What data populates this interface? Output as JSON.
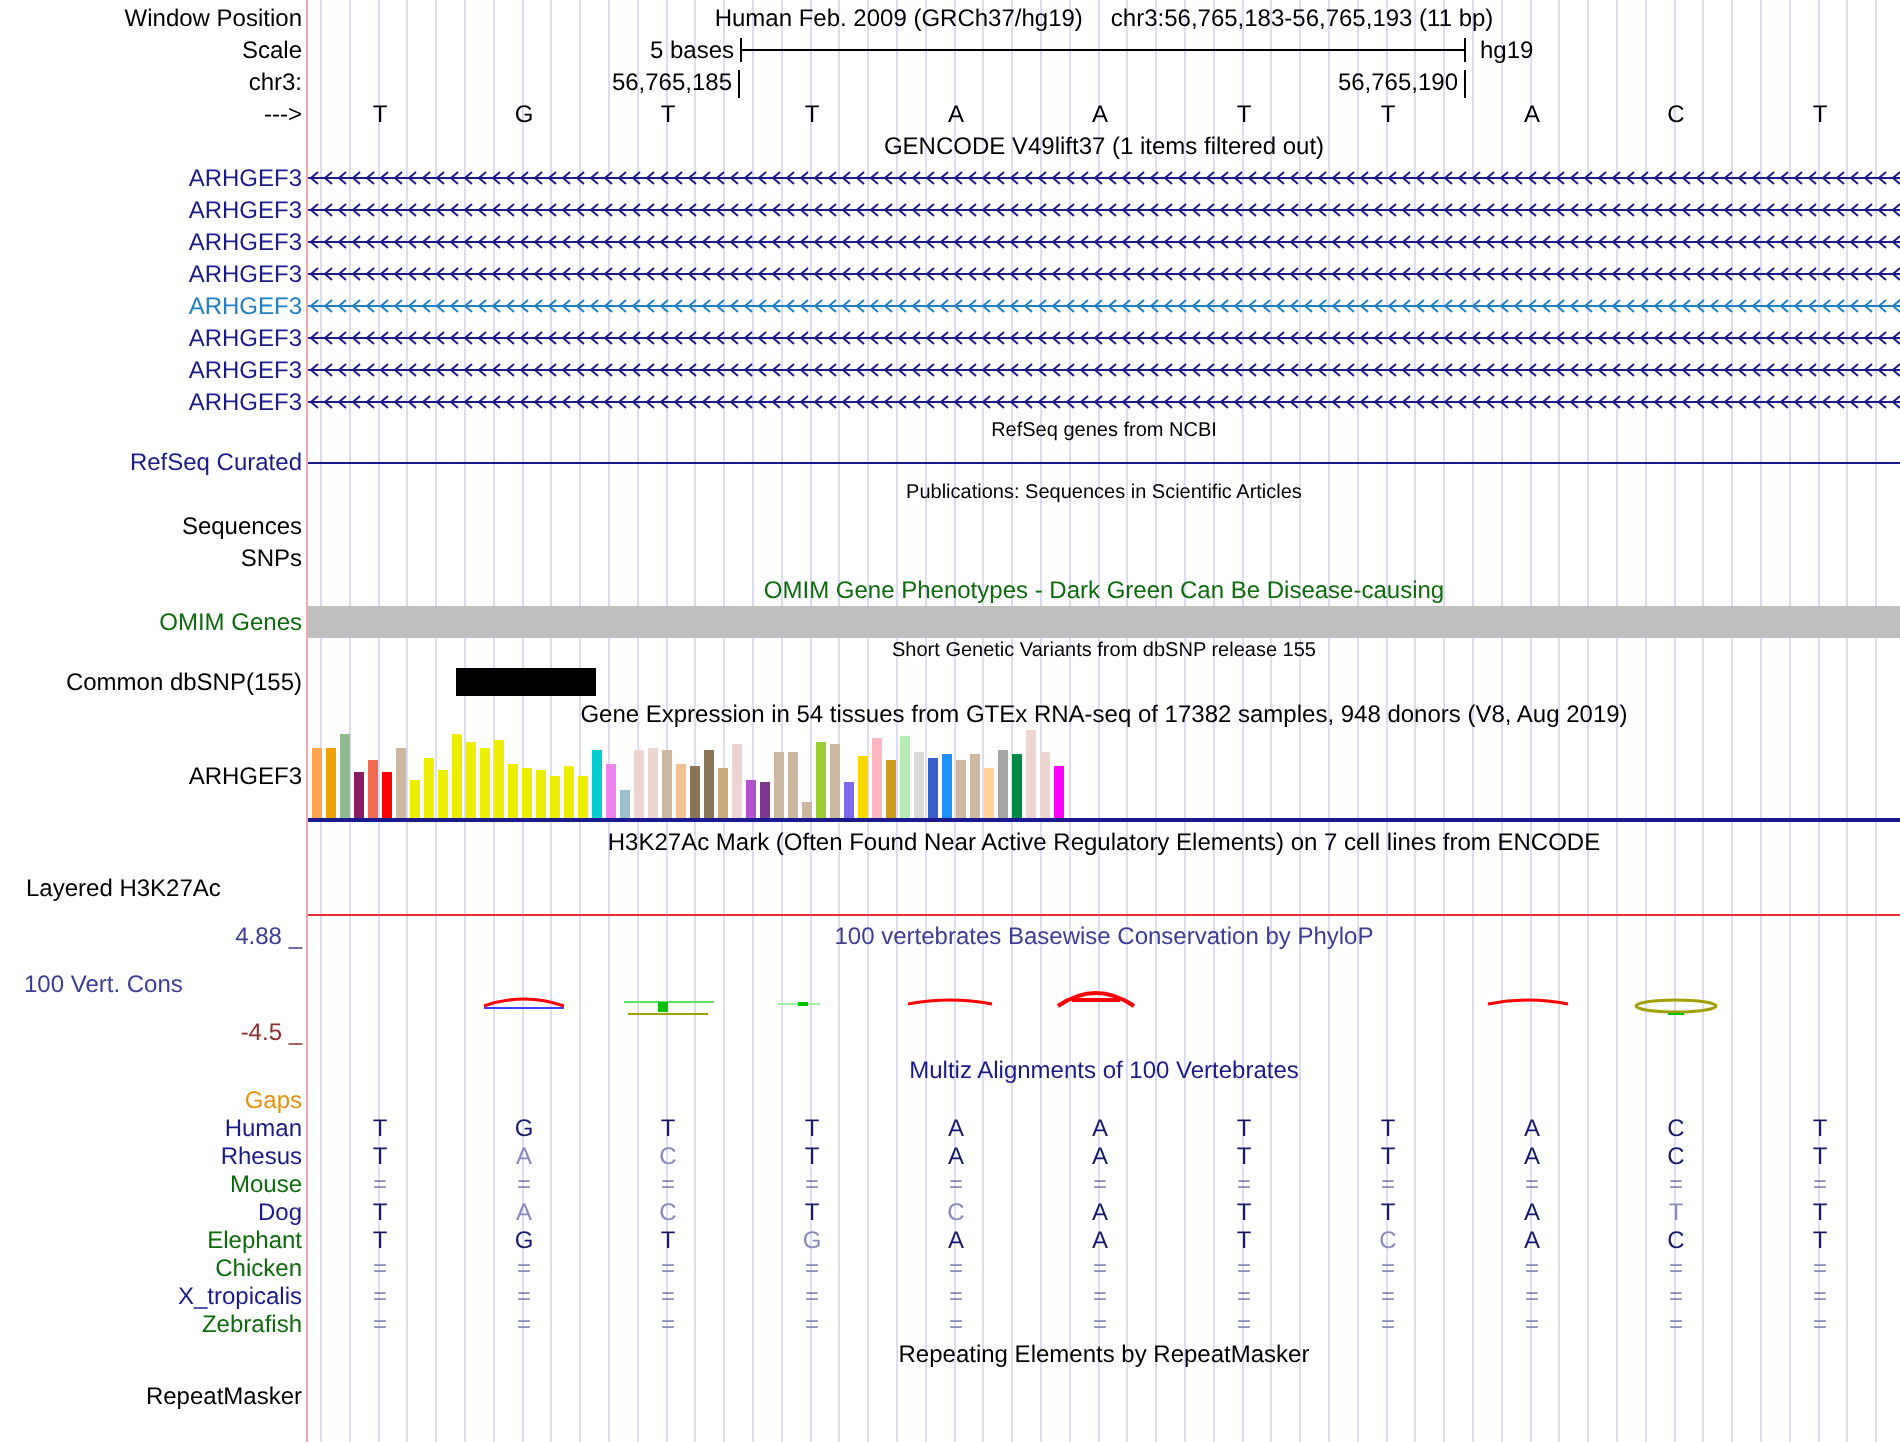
{
  "position": {
    "label": "Window Position",
    "assembly": "Human Feb. 2009 (GRCh37/hg19)",
    "range": "chr3:56,765,183-56,765,193 (11 bp)"
  },
  "scale": {
    "label": "Scale",
    "span": "5 bases",
    "assembly": "hg19"
  },
  "coordinates": {
    "label": "chr3:",
    "start": "56,765,185",
    "end": "56,765,190"
  },
  "sequence": {
    "label": "--->",
    "bases": [
      "T",
      "G",
      "T",
      "T",
      "A",
      "A",
      "T",
      "T",
      "A",
      "C",
      "T"
    ]
  },
  "gencode": {
    "title": "GENCODE V49lift37 (1 items filtered out)",
    "transcripts": [
      {
        "name": "ARHGEF3",
        "color": "#1a1a8c"
      },
      {
        "name": "ARHGEF3",
        "color": "#1a1a8c"
      },
      {
        "name": "ARHGEF3",
        "color": "#1a1a8c"
      },
      {
        "name": "ARHGEF3",
        "color": "#1a1a8c"
      },
      {
        "name": "ARHGEF3",
        "color": "#1f7fc4"
      },
      {
        "name": "ARHGEF3",
        "color": "#1a1a8c"
      },
      {
        "name": "ARHGEF3",
        "color": "#1a1a8c"
      },
      {
        "name": "ARHGEF3",
        "color": "#1a1a8c"
      }
    ]
  },
  "refseq": {
    "title": "RefSeq genes from NCBI",
    "label": "RefSeq Curated"
  },
  "publications": {
    "title": "Publications: Sequences in Scientific Articles",
    "labels": [
      "Sequences",
      "SNPs"
    ]
  },
  "omim": {
    "title": "OMIM Gene Phenotypes - Dark Green Can Be Disease-causing",
    "label": "OMIM Genes"
  },
  "dbsnp": {
    "title": "Short Genetic Variants from dbSNP release 155",
    "label": "Common dbSNP(155)"
  },
  "gtex": {
    "title": "Gene Expression in 54 tissues from GTEx RNA-seq of 17382 samples, 948 donors (V8, Aug 2019)",
    "label": "ARHGEF3"
  },
  "h3k27ac": {
    "title": "H3K27Ac Mark (Often Found Near Active Regulatory Elements) on 7 cell lines from ENCODE",
    "label": "Layered H3K27Ac"
  },
  "conservation": {
    "title": "100 vertebrates Basewise Conservation by PhyloP",
    "label": "100 Vert. Cons",
    "max": "4.88 _",
    "min": "-4.5 _"
  },
  "multiz": {
    "title": "Multiz Alignments of 100 Vertebrates",
    "gaps_label": "Gaps",
    "species": [
      {
        "name": "Human",
        "color": "#1a1a8c",
        "bases": [
          {
            "text": "T",
            "faint": false
          },
          {
            "text": "G",
            "faint": false
          },
          {
            "text": "T",
            "faint": false
          },
          {
            "text": "T",
            "faint": false
          },
          {
            "text": "A",
            "faint": false
          },
          {
            "text": "A",
            "faint": false
          },
          {
            "text": "T",
            "faint": false
          },
          {
            "text": "T",
            "faint": false
          },
          {
            "text": "A",
            "faint": false
          },
          {
            "text": "C",
            "faint": false
          },
          {
            "text": "T",
            "faint": false
          }
        ]
      },
      {
        "name": "Rhesus",
        "color": "#1a1a8c",
        "bases": [
          {
            "text": "T",
            "faint": false
          },
          {
            "text": "A",
            "faint": true
          },
          {
            "text": "C",
            "faint": true
          },
          {
            "text": "T",
            "faint": false
          },
          {
            "text": "A",
            "faint": false
          },
          {
            "text": "A",
            "faint": false
          },
          {
            "text": "T",
            "faint": false
          },
          {
            "text": "T",
            "faint": false
          },
          {
            "text": "A",
            "faint": false
          },
          {
            "text": "C",
            "faint": false
          },
          {
            "text": "T",
            "faint": false
          }
        ]
      },
      {
        "name": "Mouse",
        "color": "#0b6b0b",
        "bases": [
          {
            "text": "=",
            "faint": true
          },
          {
            "text": "=",
            "faint": true
          },
          {
            "text": "=",
            "faint": true
          },
          {
            "text": "=",
            "faint": true
          },
          {
            "text": "=",
            "faint": true
          },
          {
            "text": "=",
            "faint": true
          },
          {
            "text": "=",
            "faint": true
          },
          {
            "text": "=",
            "faint": true
          },
          {
            "text": "=",
            "faint": true
          },
          {
            "text": "=",
            "faint": true
          },
          {
            "text": "=",
            "faint": true
          }
        ]
      },
      {
        "name": "Dog",
        "color": "#1a1a8c",
        "bases": [
          {
            "text": "T",
            "faint": false
          },
          {
            "text": "A",
            "faint": true
          },
          {
            "text": "C",
            "faint": true
          },
          {
            "text": "T",
            "faint": false
          },
          {
            "text": "C",
            "faint": true
          },
          {
            "text": "A",
            "faint": false
          },
          {
            "text": "T",
            "faint": false
          },
          {
            "text": "T",
            "faint": false
          },
          {
            "text": "A",
            "faint": false
          },
          {
            "text": "T",
            "faint": true
          },
          {
            "text": "T",
            "faint": false
          }
        ]
      },
      {
        "name": "Elephant",
        "color": "#0b6b0b",
        "bases": [
          {
            "text": "T",
            "faint": false
          },
          {
            "text": "G",
            "faint": false
          },
          {
            "text": "T",
            "faint": false
          },
          {
            "text": "G",
            "faint": true
          },
          {
            "text": "A",
            "faint": false
          },
          {
            "text": "A",
            "faint": false
          },
          {
            "text": "T",
            "faint": false
          },
          {
            "text": "C",
            "faint": true
          },
          {
            "text": "A",
            "faint": false
          },
          {
            "text": "C",
            "faint": false
          },
          {
            "text": "T",
            "faint": false
          }
        ]
      },
      {
        "name": "Chicken",
        "color": "#0b6b0b",
        "bases": [
          {
            "text": "=",
            "faint": true
          },
          {
            "text": "=",
            "faint": true
          },
          {
            "text": "=",
            "faint": true
          },
          {
            "text": "=",
            "faint": true
          },
          {
            "text": "=",
            "faint": true
          },
          {
            "text": "=",
            "faint": true
          },
          {
            "text": "=",
            "faint": true
          },
          {
            "text": "=",
            "faint": true
          },
          {
            "text": "=",
            "faint": true
          },
          {
            "text": "=",
            "faint": true
          },
          {
            "text": "=",
            "faint": true
          }
        ]
      },
      {
        "name": "X_tropicalis",
        "color": "#1a1a8c",
        "bases": [
          {
            "text": "=",
            "faint": true
          },
          {
            "text": "=",
            "faint": true
          },
          {
            "text": "=",
            "faint": true
          },
          {
            "text": "=",
            "faint": true
          },
          {
            "text": "=",
            "faint": true
          },
          {
            "text": "=",
            "faint": true
          },
          {
            "text": "=",
            "faint": true
          },
          {
            "text": "=",
            "faint": true
          },
          {
            "text": "=",
            "faint": true
          },
          {
            "text": "=",
            "faint": true
          },
          {
            "text": "=",
            "faint": true
          }
        ]
      },
      {
        "name": "Zebrafish",
        "color": "#0b6b0b",
        "bases": [
          {
            "text": "=",
            "faint": true
          },
          {
            "text": "=",
            "faint": true
          },
          {
            "text": "=",
            "faint": true
          },
          {
            "text": "=",
            "faint": true
          },
          {
            "text": "=",
            "faint": true
          },
          {
            "text": "=",
            "faint": true
          },
          {
            "text": "=",
            "faint": true
          },
          {
            "text": "=",
            "faint": true
          },
          {
            "text": "=",
            "faint": true
          },
          {
            "text": "=",
            "faint": true
          },
          {
            "text": "=",
            "faint": true
          }
        ]
      }
    ]
  },
  "repeatmasker": {
    "title": "Repeating Elements by RepeatMasker",
    "label": "RepeatMasker"
  }
}
